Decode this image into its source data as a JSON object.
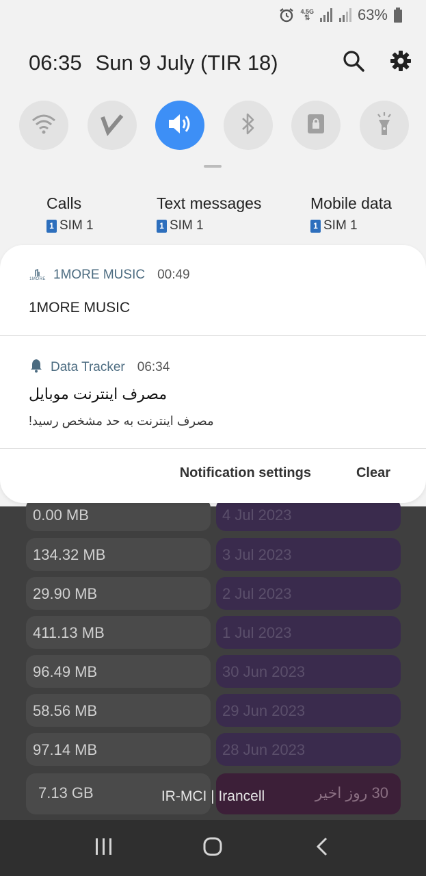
{
  "status_bar": {
    "network_label": "4.5G",
    "battery_percent": "63%"
  },
  "header": {
    "time": "06:35",
    "date": "Sun 9 July (TIR 18)"
  },
  "quick_settings": [
    {
      "name": "wifi-icon",
      "active": false
    },
    {
      "name": "vpn-icon",
      "active": false
    },
    {
      "name": "sound-icon",
      "active": true
    },
    {
      "name": "bluetooth-icon",
      "active": false
    },
    {
      "name": "screen-lock-icon",
      "active": false
    },
    {
      "name": "flashlight-icon",
      "active": false
    }
  ],
  "sim_prefs": [
    {
      "title": "Calls",
      "sim_num": "1",
      "sim": "SIM 1"
    },
    {
      "title": "Text messages",
      "sim_num": "1",
      "sim": "SIM 1"
    },
    {
      "title": "Mobile data",
      "sim_num": "1",
      "sim": "SIM 1"
    }
  ],
  "notifications": [
    {
      "app": "1MORE MUSIC",
      "time": "00:49",
      "body": "1MORE MUSIC",
      "logo_text": "1MORE"
    },
    {
      "app": "Data Tracker",
      "time": "06:34",
      "title": "مصرف اینترنت موبایل",
      "body": "مصرف اینترنت به حد مشخص رسید!"
    }
  ],
  "actions": {
    "settings": "Notification settings",
    "clear": "Clear"
  },
  "usage_rows": [
    {
      "mb": "0.00 MB",
      "date": "4 Jul 2023"
    },
    {
      "mb": "134.32 MB",
      "date": "3 Jul 2023"
    },
    {
      "mb": "29.90 MB",
      "date": "2 Jul 2023"
    },
    {
      "mb": "411.13 MB",
      "date": "1 Jul 2023"
    },
    {
      "mb": "96.49 MB",
      "date": "30 Jun 2023"
    },
    {
      "mb": "58.56 MB",
      "date": "29 Jun 2023"
    },
    {
      "mb": "97.14 MB",
      "date": "28 Jun 2023"
    }
  ],
  "total": {
    "value": "7.13 GB",
    "label": "30 روز اخیر"
  },
  "carrier": "IR-MCI | Irancell",
  "colors": {
    "accent": "#3d8ff6",
    "shade": "#f2f2f2",
    "navbar": "#2f2f2f"
  }
}
